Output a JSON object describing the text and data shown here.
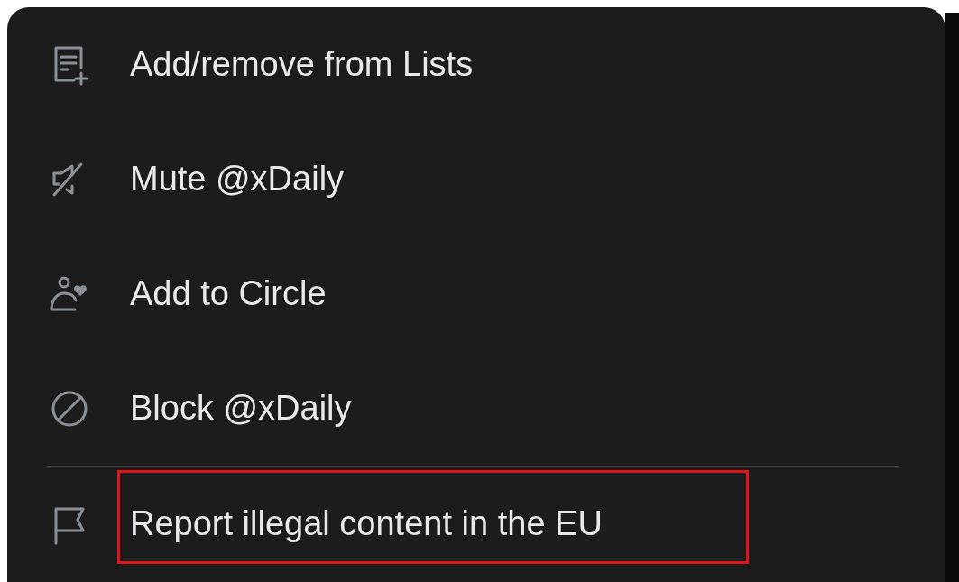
{
  "menu": {
    "items": [
      {
        "kind": "item",
        "label": "Add/remove from Lists",
        "highlighted": false
      },
      {
        "kind": "item",
        "label": "Mute @xDaily",
        "highlighted": false
      },
      {
        "kind": "item",
        "label": "Add to Circle",
        "highlighted": false
      },
      {
        "kind": "item",
        "label": "Block @xDaily",
        "highlighted": false
      },
      {
        "kind": "divider"
      },
      {
        "kind": "item",
        "label": "Report illegal content in the EU",
        "highlighted": true
      }
    ]
  }
}
